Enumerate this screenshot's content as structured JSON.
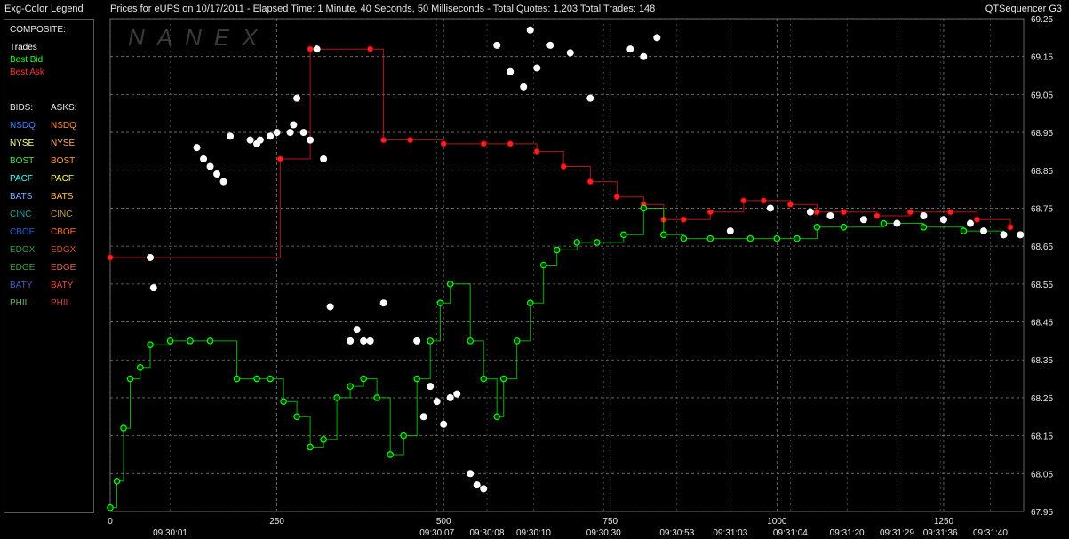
{
  "header": {
    "legend_title": "Exg-Color Legend",
    "chart_title": "Prices for  eUPS  on  10/17/2011  -  Elapsed Time: 1 Minute, 40 Seconds, 50 Milliseconds  -  Total Quotes: 1,203  Total Trades: 148",
    "app_name": "QTSequencer G3"
  },
  "legend": {
    "composite_label": "COMPOSITE:",
    "trades_label": "Trades",
    "best_bid_label": "Best Bid",
    "best_ask_label": "Best Ask",
    "bids_label": "BIDS:",
    "asks_label": "ASKS:",
    "exchanges": [
      {
        "name": "NSDQ",
        "bid": "#3f7fff",
        "ask": "#ff8a3a"
      },
      {
        "name": "NYSE",
        "bid": "#ffff80",
        "ask": "#ffb060"
      },
      {
        "name": "BOST",
        "bid": "#50e050",
        "ask": "#ff9a40"
      },
      {
        "name": "PACF",
        "bid": "#40ffff",
        "ask": "#ffff40"
      },
      {
        "name": "BATS",
        "bid": "#7fb0ff",
        "ask": "#ffc040"
      },
      {
        "name": "CINC",
        "bid": "#1fa0a0",
        "ask": "#c8a040"
      },
      {
        "name": "CBOE",
        "bid": "#2060d0",
        "ask": "#ff7020"
      },
      {
        "name": "EDGX",
        "bid": "#2f9f4f",
        "ask": "#d05030"
      },
      {
        "name": "EDGE",
        "bid": "#40a040",
        "ask": "#e06060"
      },
      {
        "name": "BATY",
        "bid": "#4060c0",
        "ask": "#ff4040"
      },
      {
        "name": "PHIL",
        "bid": "#70b070",
        "ask": "#d04040"
      }
    ],
    "colors": {
      "trades": "#ffffff",
      "best_bid": "#00ff00",
      "best_ask": "#ff2020",
      "label": "#e8e8e8"
    }
  },
  "watermark": "NANEX",
  "chart_data": {
    "type": "scatter",
    "title": "Prices for  eUPS  on  10/17/2011",
    "ylim": [
      67.95,
      69.25
    ],
    "y_ticks": [
      "69.25",
      "69.15",
      "69.05",
      "68.95",
      "68.85",
      "68.75",
      "68.65",
      "68.55",
      "68.45",
      "68.35",
      "68.25",
      "68.15",
      "68.05",
      "67.95"
    ],
    "xlim": [
      0,
      1370
    ],
    "x_ticks": [
      "0",
      "250",
      "500",
      "750",
      "1000",
      "1250"
    ],
    "x_tick_values": [
      0,
      250,
      500,
      750,
      1000,
      1250
    ],
    "time_labels": [
      {
        "seq": 90,
        "label": "09:30:01"
      },
      {
        "seq": 490,
        "label": "09:30:07"
      },
      {
        "seq": 565,
        "label": "09:30:08"
      },
      {
        "seq": 635,
        "label": "09:30:10"
      },
      {
        "seq": 740,
        "label": "09:30:30"
      },
      {
        "seq": 850,
        "label": "09:30:53"
      },
      {
        "seq": 930,
        "label": "09:31:03"
      },
      {
        "seq": 1020,
        "label": "09:31:04"
      },
      {
        "seq": 1105,
        "label": "09:31:20"
      },
      {
        "seq": 1180,
        "label": "09:31:29"
      },
      {
        "seq": 1245,
        "label": "09:31:36"
      },
      {
        "seq": 1320,
        "label": "09:31:40"
      }
    ],
    "grid": true,
    "series": [
      {
        "name": "Best Ask",
        "color": "#ff2020",
        "points": [
          [
            0,
            68.62
          ],
          [
            60,
            68.62
          ],
          [
            255,
            68.88
          ],
          [
            300,
            69.17
          ],
          [
            390,
            69.17
          ],
          [
            410,
            68.93
          ],
          [
            450,
            68.93
          ],
          [
            500,
            68.92
          ],
          [
            560,
            68.92
          ],
          [
            600,
            68.92
          ],
          [
            640,
            68.9
          ],
          [
            680,
            68.86
          ],
          [
            720,
            68.82
          ],
          [
            760,
            68.78
          ],
          [
            800,
            68.76
          ],
          [
            830,
            68.72
          ],
          [
            860,
            68.72
          ],
          [
            900,
            68.74
          ],
          [
            950,
            68.77
          ],
          [
            980,
            68.77
          ],
          [
            1020,
            68.76
          ],
          [
            1060,
            68.74
          ],
          [
            1100,
            68.74
          ],
          [
            1150,
            68.73
          ],
          [
            1200,
            68.74
          ],
          [
            1260,
            68.74
          ],
          [
            1300,
            68.72
          ],
          [
            1350,
            68.7
          ]
        ]
      },
      {
        "name": "Best Bid",
        "color": "#00ff00",
        "points": [
          [
            0,
            67.96
          ],
          [
            10,
            68.03
          ],
          [
            20,
            68.17
          ],
          [
            30,
            68.3
          ],
          [
            45,
            68.33
          ],
          [
            60,
            68.39
          ],
          [
            90,
            68.4
          ],
          [
            120,
            68.4
          ],
          [
            150,
            68.4
          ],
          [
            190,
            68.3
          ],
          [
            220,
            68.3
          ],
          [
            240,
            68.3
          ],
          [
            260,
            68.24
          ],
          [
            280,
            68.2
          ],
          [
            300,
            68.12
          ],
          [
            320,
            68.14
          ],
          [
            340,
            68.25
          ],
          [
            360,
            68.28
          ],
          [
            380,
            68.3
          ],
          [
            400,
            68.25
          ],
          [
            420,
            68.1
          ],
          [
            440,
            68.15
          ],
          [
            460,
            68.3
          ],
          [
            480,
            68.4
          ],
          [
            495,
            68.5
          ],
          [
            510,
            68.55
          ],
          [
            540,
            68.4
          ],
          [
            560,
            68.3
          ],
          [
            580,
            68.2
          ],
          [
            590,
            68.3
          ],
          [
            610,
            68.4
          ],
          [
            630,
            68.5
          ],
          [
            650,
            68.6
          ],
          [
            670,
            68.64
          ],
          [
            700,
            68.66
          ],
          [
            730,
            68.66
          ],
          [
            770,
            68.68
          ],
          [
            800,
            68.75
          ],
          [
            830,
            68.68
          ],
          [
            860,
            68.67
          ],
          [
            900,
            68.67
          ],
          [
            960,
            68.67
          ],
          [
            1000,
            68.67
          ],
          [
            1030,
            68.67
          ],
          [
            1060,
            68.7
          ],
          [
            1100,
            68.7
          ],
          [
            1160,
            68.71
          ],
          [
            1220,
            68.7
          ],
          [
            1280,
            68.69
          ],
          [
            1340,
            68.68
          ]
        ]
      },
      {
        "name": "Trades",
        "color": "#ffffff",
        "points": [
          [
            60,
            68.62
          ],
          [
            65,
            68.54
          ],
          [
            130,
            68.91
          ],
          [
            140,
            68.88
          ],
          [
            150,
            68.86
          ],
          [
            160,
            68.84
          ],
          [
            170,
            68.82
          ],
          [
            180,
            68.94
          ],
          [
            210,
            68.93
          ],
          [
            220,
            68.92
          ],
          [
            225,
            68.93
          ],
          [
            240,
            68.94
          ],
          [
            250,
            68.95
          ],
          [
            270,
            68.95
          ],
          [
            275,
            68.97
          ],
          [
            280,
            69.04
          ],
          [
            290,
            68.95
          ],
          [
            300,
            68.93
          ],
          [
            310,
            69.17
          ],
          [
            320,
            68.88
          ],
          [
            330,
            68.49
          ],
          [
            360,
            68.4
          ],
          [
            370,
            68.43
          ],
          [
            380,
            68.4
          ],
          [
            390,
            68.4
          ],
          [
            410,
            68.5
          ],
          [
            460,
            68.4
          ],
          [
            470,
            68.2
          ],
          [
            480,
            68.28
          ],
          [
            490,
            68.24
          ],
          [
            500,
            68.18
          ],
          [
            510,
            68.25
          ],
          [
            520,
            68.26
          ],
          [
            540,
            68.05
          ],
          [
            550,
            68.02
          ],
          [
            560,
            68.01
          ],
          [
            580,
            69.18
          ],
          [
            600,
            69.11
          ],
          [
            620,
            69.07
          ],
          [
            630,
            69.22
          ],
          [
            640,
            69.12
          ],
          [
            660,
            69.18
          ],
          [
            690,
            69.16
          ],
          [
            720,
            69.04
          ],
          [
            780,
            69.17
          ],
          [
            800,
            69.15
          ],
          [
            820,
            69.2
          ],
          [
            930,
            68.69
          ],
          [
            990,
            68.75
          ],
          [
            1050,
            68.74
          ],
          [
            1080,
            68.73
          ],
          [
            1130,
            68.72
          ],
          [
            1180,
            68.71
          ],
          [
            1220,
            68.73
          ],
          [
            1250,
            68.72
          ],
          [
            1290,
            68.71
          ],
          [
            1310,
            68.69
          ],
          [
            1340,
            68.68
          ],
          [
            1365,
            68.68
          ]
        ]
      }
    ]
  }
}
